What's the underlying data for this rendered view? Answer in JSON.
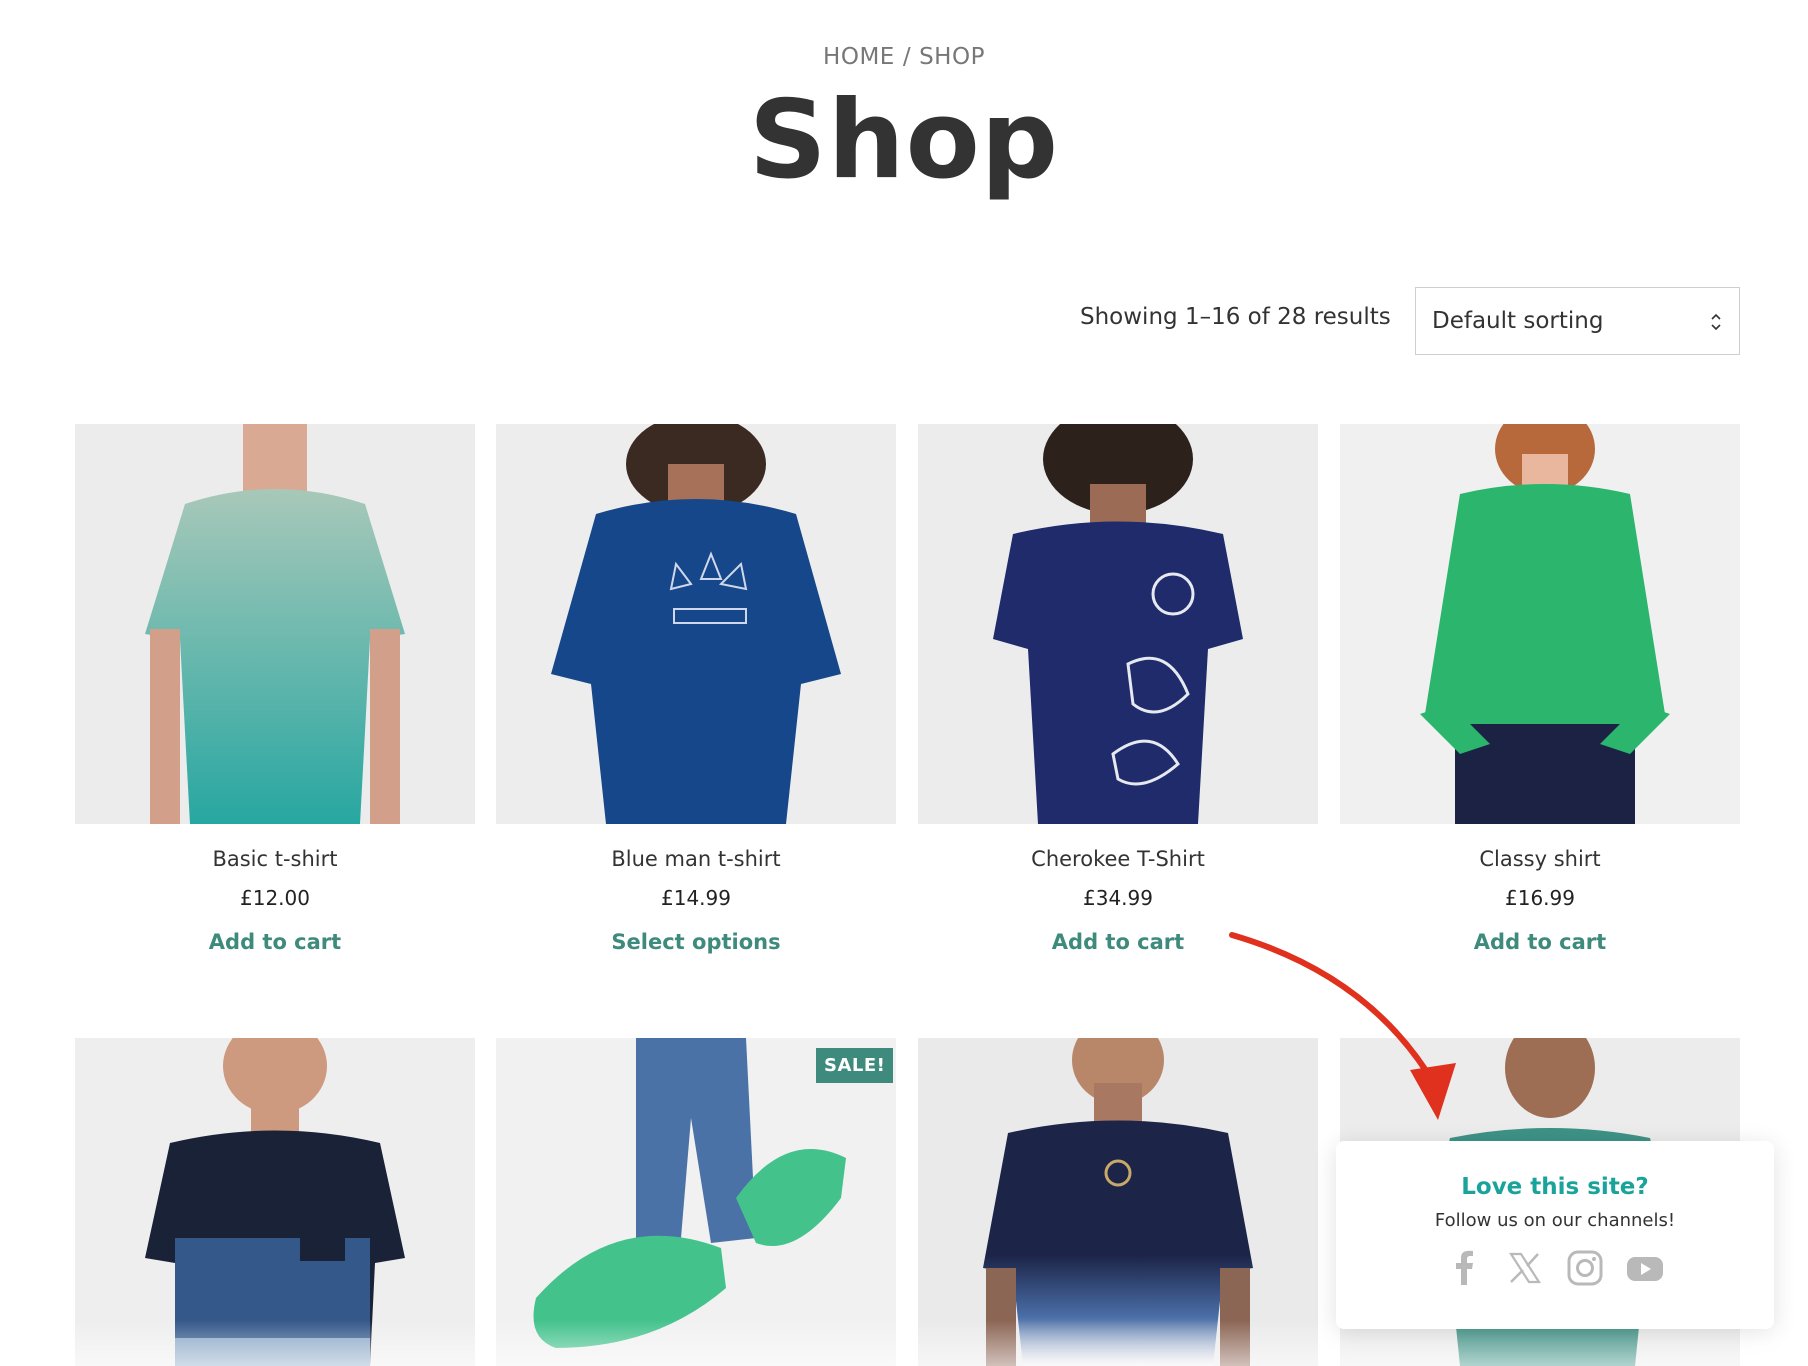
{
  "breadcrumb": {
    "home": "HOME",
    "separator": "/",
    "current": "SHOP"
  },
  "page_title": "Shop",
  "result_count": "Showing 1–16 of 28 results",
  "sorting": {
    "selected": "Default sorting"
  },
  "products": [
    {
      "name": "Basic t-shirt",
      "price": "£12.00",
      "cta": "Add to cart",
      "image": "man in mint-to-teal gradient t-shirt",
      "shirt_color": "#7fc3b6"
    },
    {
      "name": "Blue man t-shirt",
      "price": "£14.99",
      "cta": "Select options",
      "image": "man in blue adidas t-shirt",
      "shirt_color": "#16478a"
    },
    {
      "name": "Cherokee T-Shirt",
      "price": "£34.99",
      "cta": "Add to cart",
      "image": "woman in navy floral t-shirt",
      "shirt_color": "#1f2b6b"
    },
    {
      "name": "Classy shirt",
      "price": "£16.99",
      "cta": "Add to cart",
      "image": "woman in green blouse",
      "shirt_color": "#2bb56d"
    },
    {
      "image": "man in navy and blue color-block t-shirt",
      "shirt_color": "#2c4f7c"
    },
    {
      "image": "green espadrilles with jeans",
      "badge": "SALE!",
      "shirt_color": "#43c28c"
    },
    {
      "image": "tattooed man in navy-to-white dip-dye t-shirt",
      "shirt_color": "#1c2548"
    },
    {
      "image": "man in teal polo shirt",
      "shirt_color": "#3e9286"
    }
  ],
  "follow_popup": {
    "title": "Love this site?",
    "subtitle": "Follow us on our channels!",
    "icons": [
      "facebook-icon",
      "x-icon",
      "instagram-icon",
      "youtube-icon"
    ]
  },
  "colors": {
    "accent": "#3e8a7c",
    "popup_title": "#1aa39a",
    "annotation_arrow": "#e0301e"
  }
}
